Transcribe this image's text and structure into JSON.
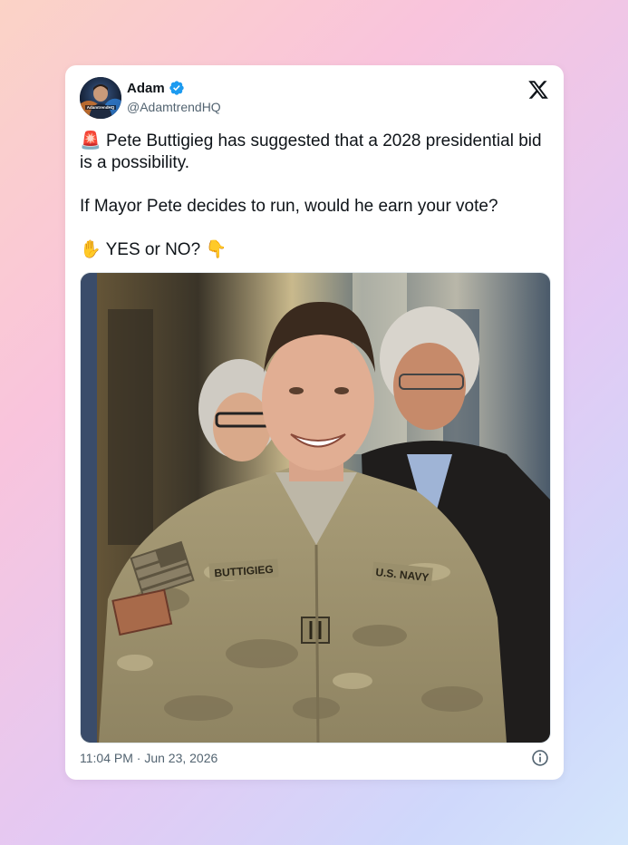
{
  "tweet": {
    "display_name": "Adam",
    "handle": "@AdamtrendHQ",
    "verified": true,
    "line1_emoji": "🚨",
    "line1_text": " Pete Buttigieg has suggested that a 2028 presidential bid is a possibility.",
    "line2_text": "If Mayor Pete decides to run, would he earn your vote?",
    "line3_emoji_start": "✋",
    "line3_text": " YES or NO? ",
    "line3_emoji_end": "👇",
    "timestamp": "11:04 PM · Jun 23, 2026"
  },
  "media": {
    "patch_name": "BUTTIGIEG",
    "patch_branch": "U.S. NAVY"
  },
  "icons": {
    "logo": "x-logo-icon",
    "verified": "verified-badge-icon",
    "info": "info-icon"
  },
  "colors": {
    "verified_blue": "#1d9bf0",
    "text_primary": "#0f1419",
    "text_secondary": "#536471"
  }
}
